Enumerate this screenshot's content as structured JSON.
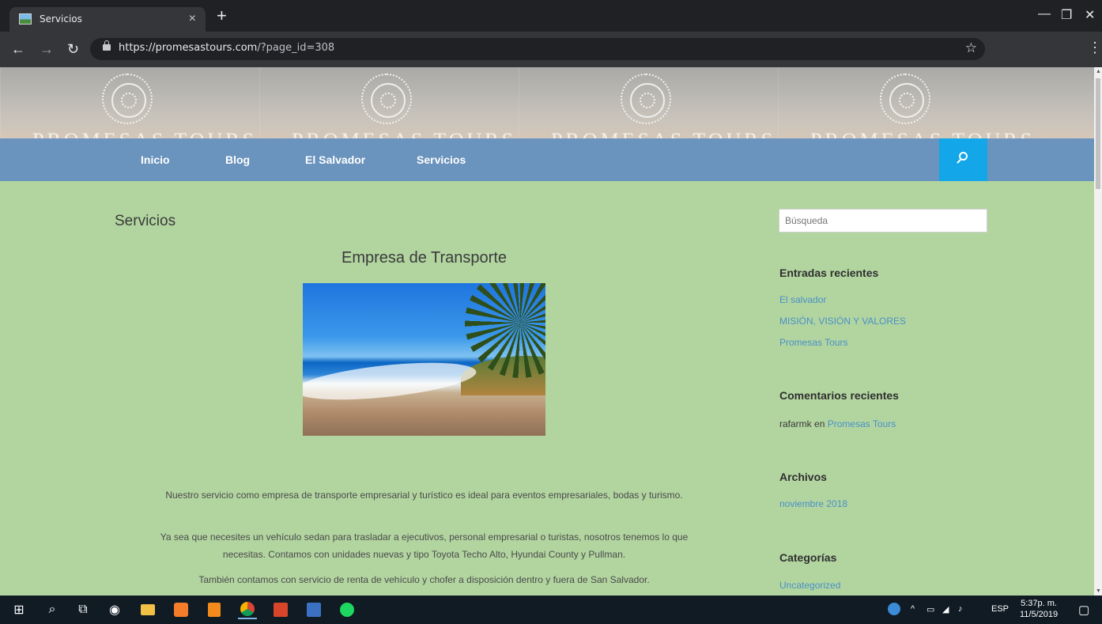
{
  "browser": {
    "tab_title": "Servicios",
    "tab_close": "×",
    "new_tab": "+",
    "url_host": "https://promesastours.com",
    "url_path": "/?page_id=308",
    "star": "☆"
  },
  "site": {
    "brand": "PROMESAS TOURS",
    "nav": [
      "Inicio",
      "Blog",
      "El Salvador",
      "Servicios"
    ]
  },
  "page": {
    "title": "Servicios",
    "post_title": "Empresa de Transporte",
    "paragraphs": [
      "Nuestro servicio como empresa de transporte empresarial y turístico es ideal para eventos empresariales, bodas y turismo.",
      "Ya sea que necesites un vehículo sedan para trasladar a ejecutivos, personal empresarial o turistas, nosotros tenemos lo que necesitas. Contamos con unidades nuevas y tipo Toyota Techo Alto, Hyundai County y Pullman.",
      "También contamos con servicio de renta de vehículo y chofer a disposición dentro y fuera de San Salvador."
    ]
  },
  "sidebar": {
    "search_placeholder": "Búsqueda",
    "recent_posts_title": "Entradas recientes",
    "recent_posts": [
      "El salvador",
      "MISIÓN, VISIÓN Y VALORES",
      "Promesas Tours"
    ],
    "recent_comments_title": "Comentarios recientes",
    "comment_author": "rafarmk",
    "comment_on": "en",
    "comment_post": "Promesas Tours",
    "archives_title": "Archivos",
    "archives": [
      "noviembre 2018"
    ],
    "categories_title": "Categorías",
    "categories": [
      "Uncategorized"
    ]
  },
  "taskbar": {
    "language": "ESP",
    "time": "5:37p. m.",
    "date": "11/5/2019"
  },
  "colors": {
    "page_bg": "#b2d5a0",
    "nav_bg": "#6a93bd",
    "search_btn": "#13a6e8",
    "link": "#4a90c6"
  }
}
